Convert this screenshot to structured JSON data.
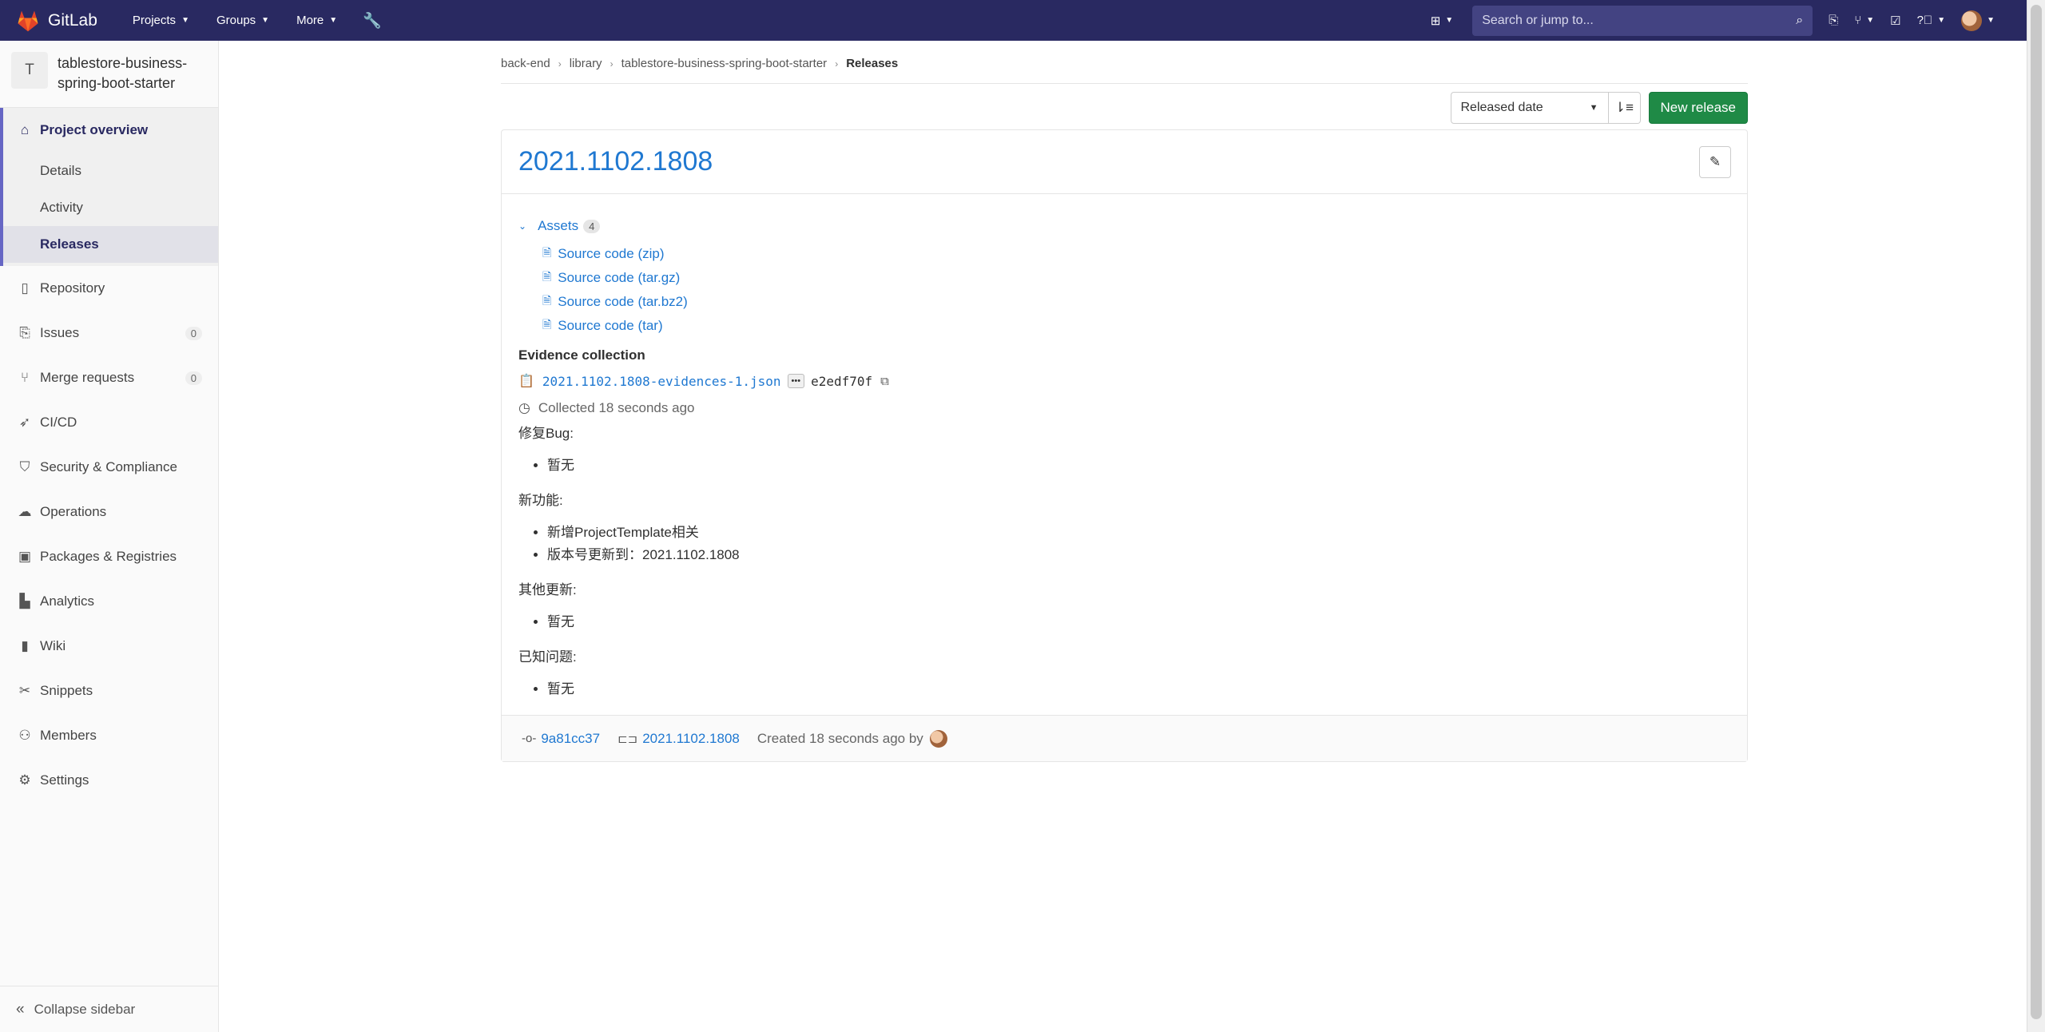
{
  "navbar": {
    "brand": "GitLab",
    "menu": [
      {
        "label": "Projects"
      },
      {
        "label": "Groups"
      },
      {
        "label": "More"
      }
    ],
    "search_placeholder": "Search or jump to..."
  },
  "sidebar": {
    "project_avatar_letter": "T",
    "project_name": "tablestore-business-spring-boot-starter",
    "overview": {
      "label": "Project overview",
      "subitems": [
        {
          "label": "Details"
        },
        {
          "label": "Activity"
        },
        {
          "label": "Releases"
        }
      ]
    },
    "items": [
      {
        "label": "Repository",
        "icon": "book-icon"
      },
      {
        "label": "Issues",
        "icon": "issues-icon",
        "count": "0"
      },
      {
        "label": "Merge requests",
        "icon": "merge-request-icon",
        "count": "0"
      },
      {
        "label": "CI/CD",
        "icon": "rocket-icon"
      },
      {
        "label": "Security & Compliance",
        "icon": "shield-icon"
      },
      {
        "label": "Operations",
        "icon": "cloud-gear-icon"
      },
      {
        "label": "Packages & Registries",
        "icon": "package-icon"
      },
      {
        "label": "Analytics",
        "icon": "chart-icon"
      },
      {
        "label": "Wiki",
        "icon": "book-icon"
      },
      {
        "label": "Snippets",
        "icon": "scissors-icon"
      },
      {
        "label": "Members",
        "icon": "users-icon"
      },
      {
        "label": "Settings",
        "icon": "gear-icon"
      }
    ],
    "collapse_label": "Collapse sidebar"
  },
  "breadcrumb": [
    "back-end",
    "library",
    "tablestore-business-spring-boot-starter",
    "Releases"
  ],
  "toolbar": {
    "sort_value": "Released date",
    "new_release_label": "New release"
  },
  "release": {
    "title": "2021.1102.1808",
    "assets_label": "Assets",
    "assets_count": "4",
    "assets": [
      {
        "label": "Source code (zip)"
      },
      {
        "label": "Source code (tar.gz)"
      },
      {
        "label": "Source code (tar.bz2)"
      },
      {
        "label": "Source code (tar)"
      }
    ],
    "evidence_title": "Evidence collection",
    "evidence_file": "2021.1102.1808-evidences-1.json",
    "evidence_more": "•••",
    "evidence_sha": "e2edf70f",
    "collected": "Collected 18 seconds ago",
    "notes": {
      "h1": "修复Bug:",
      "l1": [
        "暂无"
      ],
      "h2": "新功能:",
      "l2": [
        "新增ProjectTemplate相关",
        "版本号更新到：2021.1102.1808"
      ],
      "h3": "其他更新:",
      "l3": [
        "暂无"
      ],
      "h4": "已知问题:",
      "l4": [
        "暂无"
      ]
    },
    "footer": {
      "commit": "9a81cc37",
      "tag": "2021.1102.1808",
      "created": "Created 18 seconds ago by"
    }
  }
}
